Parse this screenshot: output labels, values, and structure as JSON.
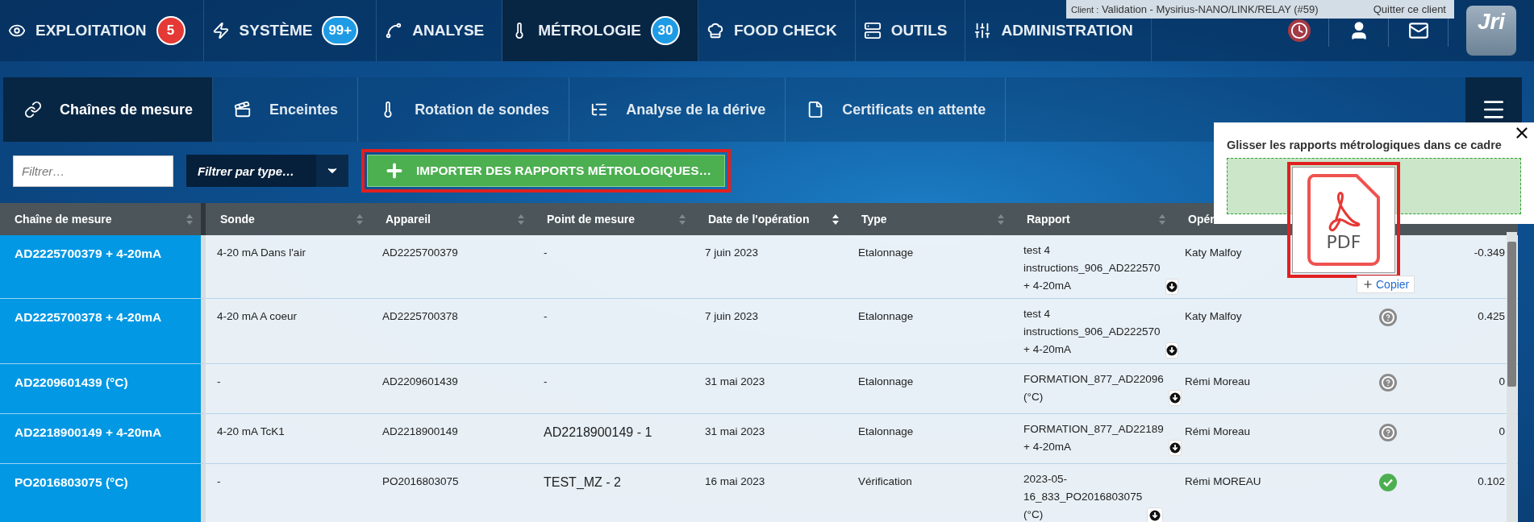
{
  "nav": {
    "items": [
      {
        "label": "EXPLOITATION",
        "selected": false,
        "badge": {
          "text": "5",
          "color": "#e53935"
        }
      },
      {
        "label": "SYSTÈME",
        "selected": false,
        "badge": {
          "text": "99+",
          "color": "#1e9be5"
        }
      },
      {
        "label": "ANALYSE",
        "selected": false
      },
      {
        "label": "MÉTROLOGIE",
        "selected": true,
        "badge": {
          "text": "30",
          "color": "#1e9be5"
        }
      },
      {
        "label": "FOOD CHECK",
        "selected": false
      },
      {
        "label": "OUTILS",
        "selected": false
      },
      {
        "label": "ADMINISTRATION",
        "selected": false
      }
    ],
    "client_bar": {
      "prefix": "Client :",
      "name": "Validation - Mysirius-NANO/LINK/RELAY (#59)",
      "action": "Quitter ce client"
    },
    "logo_text": "Jri"
  },
  "subtabs": [
    {
      "label": "Chaînes de mesure",
      "selected": true
    },
    {
      "label": "Enceintes",
      "selected": false
    },
    {
      "label": "Rotation de sondes",
      "selected": false
    },
    {
      "label": "Analyse de la dérive",
      "selected": false
    },
    {
      "label": "Certificats en attente",
      "selected": false
    }
  ],
  "toolbar": {
    "filter": {
      "placeholder": "Filtrer…"
    },
    "type_select": {
      "placeholder": "Filtrer par type…"
    },
    "import_button": {
      "label": "IMPORTER DES RAPPORTS MÉTROLOGIQUES…",
      "highlighted": true
    }
  },
  "table": {
    "columns": [
      {
        "label": "Chaîne de mesure",
        "kind": "sortable",
        "sorted": false
      },
      {
        "label": "Sonde",
        "kind": "sortable",
        "sorted": false
      },
      {
        "label": "Appareil",
        "kind": "sortable",
        "sorted": false
      },
      {
        "label": "Point de mesure",
        "kind": "sortable",
        "sorted": false
      },
      {
        "label": "Date de l'opération",
        "kind": "sortable",
        "sorted": true
      },
      {
        "label": "Type",
        "kind": "sortable",
        "sorted": false
      },
      {
        "label": "Rapport",
        "kind": "sortable",
        "sorted": false
      },
      {
        "label": "Opér",
        "kind": "plain"
      }
    ],
    "rows": [
      {
        "chain": "AD2225700379 + 4-20mA",
        "probe": "4-20 mA Dans l'air",
        "device": "AD2225700379",
        "point": "-",
        "point_emphasis": false,
        "date": "7 juin 2023",
        "type": "Etalonnage",
        "report": [
          "test 4",
          "instructions_906_AD222570",
          "+ 4-20mA"
        ],
        "operator": "Katy Malfoy",
        "value": "-0.349"
      },
      {
        "chain": "AD2225700378 + 4-20mA",
        "probe": "4-20 mA A coeur",
        "device": "AD2225700378",
        "point": "-",
        "point_emphasis": false,
        "date": "7 juin 2023",
        "type": "Etalonnage",
        "report": [
          "test 4",
          "instructions_906_AD222570",
          "+ 4-20mA"
        ],
        "operator": "Katy Malfoy",
        "verified": false,
        "value": "0.425"
      },
      {
        "chain": "AD2209601439 (°C)",
        "probe": "-",
        "device": "AD2209601439",
        "point": "-",
        "point_emphasis": false,
        "date": "31 mai 2023",
        "type": "Etalonnage",
        "report": [
          "FORMATION_877_AD22096",
          "(°C)"
        ],
        "operator": "Rémi Moreau",
        "verified": false,
        "value": "0"
      },
      {
        "chain": "AD2218900149 + 4-20mA",
        "probe": "4-20 mA TcK1",
        "device": "AD2218900149",
        "point": "AD2218900149 - 1",
        "point_emphasis": true,
        "date": "31 mai 2023",
        "type": "Etalonnage",
        "report": [
          "FORMATION_877_AD22189",
          "+ 4-20mA"
        ],
        "operator": "Rémi Moreau",
        "verified": false,
        "value": "0"
      },
      {
        "chain": "PO2016803075 (°C)",
        "probe": "-",
        "device": "PO2016803075",
        "point": "TEST_MZ - 2",
        "point_emphasis": true,
        "date": "16 mai 2023",
        "type": "Vérification",
        "report": [
          "2023-05-",
          "16_833_PO2016803075",
          "(°C)"
        ],
        "operator": "Rémi MOREAU",
        "verified": true,
        "value": "0.102"
      }
    ]
  },
  "drop_panel": {
    "title": "Glisser les rapports métrologiques dans ce cadre",
    "dragged_file": {
      "label": "PDF",
      "highlighted": true
    },
    "tooltip": "Copier"
  }
}
